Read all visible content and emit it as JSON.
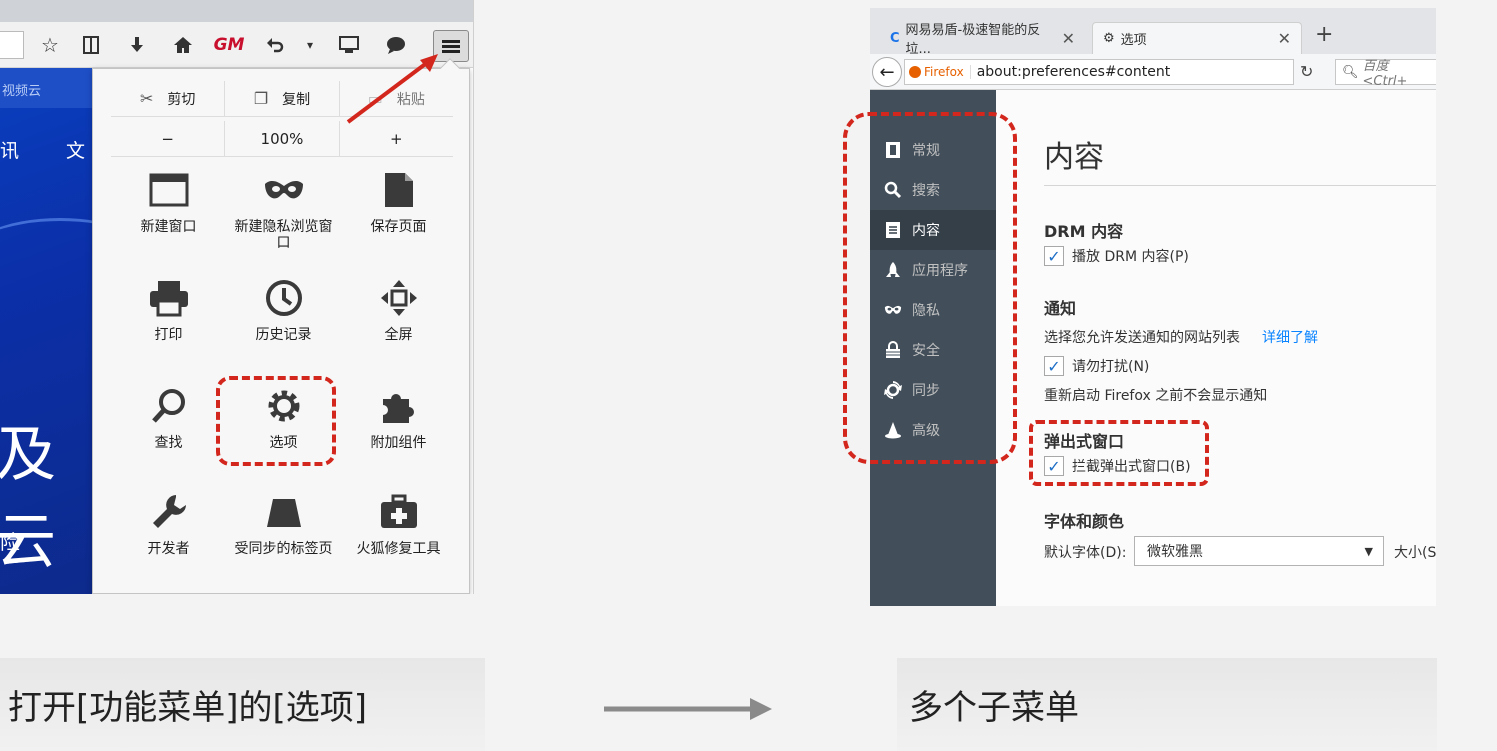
{
  "left": {
    "site": {
      "top_text": "视频云",
      "nav_1": "讯",
      "nav_2": "文",
      "big_text": "及云",
      "sub_text": "险"
    },
    "toolbar": {
      "icons": [
        "star-icon",
        "reading-list-icon",
        "download-icon",
        "home-icon",
        "gm-icon",
        "undo-icon",
        "dropdown-icon",
        "screen-icon",
        "chat-icon",
        "hamburger-menu-icon"
      ]
    },
    "menu": {
      "edit": {
        "cut": "剪切",
        "copy": "复制",
        "paste": "粘贴"
      },
      "zoom": {
        "minus": "−",
        "level": "100%",
        "plus": "+"
      },
      "items": [
        {
          "label": "新建窗口",
          "icon": "new-window-icon"
        },
        {
          "label": "新建隐私浏览窗口",
          "icon": "private-mask-icon"
        },
        {
          "label": "保存页面",
          "icon": "save-page-icon"
        },
        {
          "label": "打印",
          "icon": "print-icon"
        },
        {
          "label": "历史记录",
          "icon": "history-clock-icon"
        },
        {
          "label": "全屏",
          "icon": "fullscreen-icon"
        },
        {
          "label": "查找",
          "icon": "find-magnifier-icon"
        },
        {
          "label": "选项",
          "icon": "options-gear-icon"
        },
        {
          "label": "附加组件",
          "icon": "addons-puzzle-icon"
        },
        {
          "label": "开发者",
          "icon": "developer-wrench-icon"
        },
        {
          "label": "受同步的标签页",
          "icon": "synced-tabs-icon"
        },
        {
          "label": "火狐修复工具",
          "icon": "repair-toolkit-icon"
        }
      ]
    }
  },
  "right": {
    "tabs": [
      {
        "title": "网易易盾-极速智能的反垃...",
        "close": "✕"
      },
      {
        "title": "选项",
        "close": "✕"
      }
    ],
    "new_tab": "+",
    "identity": "Firefox",
    "url": "about:preferences#content",
    "search_placeholder": "百度 <Ctrl+",
    "sidebar": [
      {
        "label": "常规",
        "icon": "general-icon",
        "active": false
      },
      {
        "label": "搜索",
        "icon": "search-icon",
        "active": false
      },
      {
        "label": "内容",
        "icon": "content-page-icon",
        "active": true
      },
      {
        "label": "应用程序",
        "icon": "applications-rocket-icon",
        "active": false
      },
      {
        "label": "隐私",
        "icon": "privacy-mask-icon",
        "active": false
      },
      {
        "label": "安全",
        "icon": "security-lock-icon",
        "active": false
      },
      {
        "label": "同步",
        "icon": "sync-icon",
        "active": false
      },
      {
        "label": "高级",
        "icon": "advanced-wizard-icon",
        "active": false
      }
    ],
    "content": {
      "heading": "内容",
      "drm_title": "DRM 内容",
      "drm_checkbox": "播放 DRM 内容(P)",
      "notify_title": "通知",
      "notify_text": "选择您允许发送通知的网站列表",
      "notify_link": "详细了解",
      "dnd_checkbox": "请勿打扰(N)",
      "restart_note": "重新启动 Firefox 之前不会显示通知",
      "popup_title": "弹出式窗口",
      "popup_checkbox": "拦截弹出式窗口(B)",
      "fonts_title": "字体和颜色",
      "default_font_label": "默认字体(D):",
      "default_font_value": "微软雅黑",
      "size_label": "大小(S"
    }
  },
  "captions": {
    "left": "打开[功能菜单]的[选项]",
    "right": "多个子菜单"
  },
  "colors": {
    "annotation_red": "#d3261c",
    "sidebar_bg": "#424f5a",
    "link_blue": "#0a84ff"
  }
}
